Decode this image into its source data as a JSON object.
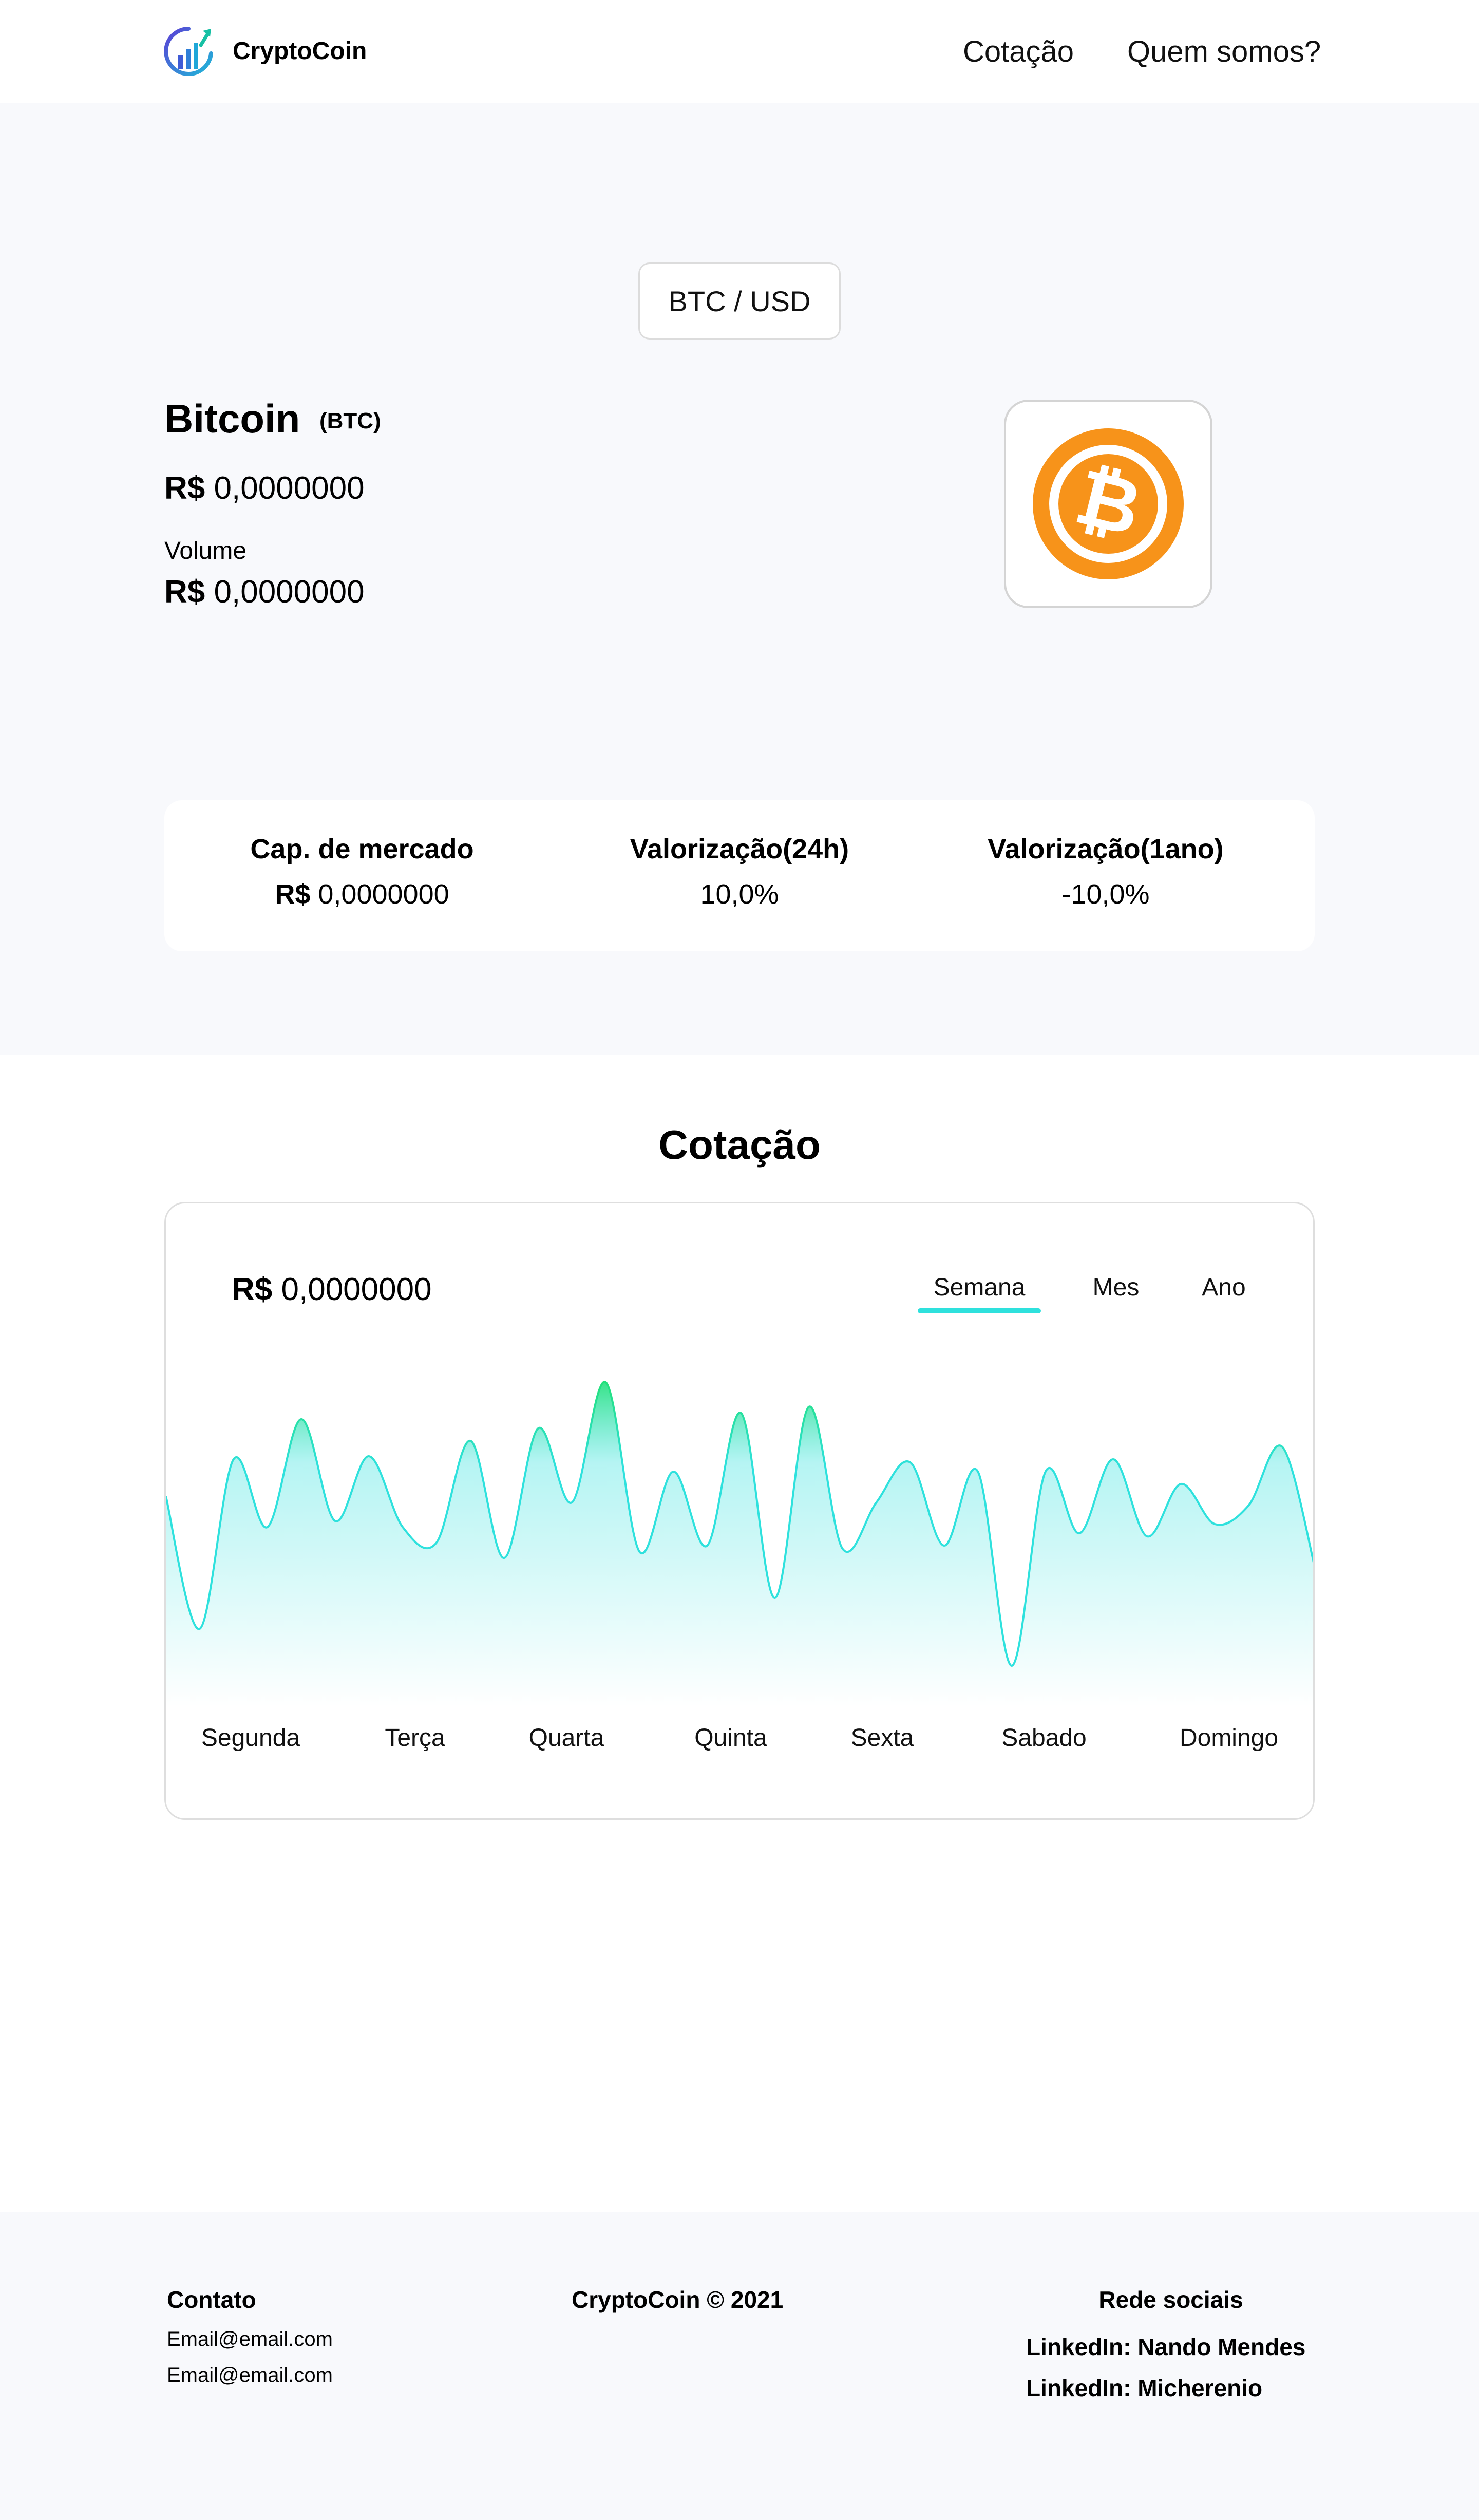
{
  "header": {
    "brand": "CryptoCoin",
    "nav": [
      "Cotação",
      "Quem somos?"
    ]
  },
  "hero": {
    "pair_button": "BTC / USD",
    "coin_name": "Bitcoin",
    "coin_symbol": "(BTC)",
    "currency": "R$",
    "price": "0,0000000",
    "volume_label": "Volume",
    "volume": "0,0000000"
  },
  "stats": [
    {
      "title": "Cap. de mercado",
      "currency": "R$",
      "value": "0,0000000"
    },
    {
      "title": "Valorização(24h)",
      "value": "10,0%"
    },
    {
      "title": "Valorização(1ano)",
      "value": "-10,0%"
    }
  ],
  "cotacao": {
    "title": "Cotação",
    "currency": "R$",
    "price": "0,0000000",
    "tabs": [
      "Semana",
      "Mes",
      "Ano"
    ],
    "active_tab": "Semana",
    "accent_color": "#2ee1dd",
    "highlight_color": "#22e07a",
    "days": [
      "Segunda",
      "Terça",
      "Quarta",
      "Quinta",
      "Sexta",
      "Sabado",
      "Domingo"
    ]
  },
  "chart_data": {
    "type": "area",
    "title": "",
    "xlabel": "",
    "ylabel": "",
    "categories": [
      "Segunda",
      "Terça",
      "Quarta",
      "Quinta",
      "Sexta",
      "Sabado",
      "Domingo"
    ],
    "grid": false,
    "series": [
      {
        "values": [
          0.55,
          0.12,
          0.67,
          0.45,
          0.8,
          0.47,
          0.68,
          0.45,
          0.4,
          0.73,
          0.35,
          0.77,
          0.53,
          0.92,
          0.37,
          0.63,
          0.39,
          0.82,
          0.22,
          0.84,
          0.38,
          0.53,
          0.66,
          0.39,
          0.63,
          0.0,
          0.63,
          0.43,
          0.67,
          0.42,
          0.59,
          0.46,
          0.52,
          0.71,
          0.3
        ]
      }
    ]
  },
  "footer": {
    "contact_title": "Contato",
    "emails": [
      "Email@email.com",
      "Email@email.com"
    ],
    "copyright": "CryptoCoin © 2021",
    "social_title": "Rede sociais",
    "links": [
      "LinkedIn: Nando Mendes",
      "LinkedIn: Micherenio"
    ]
  }
}
